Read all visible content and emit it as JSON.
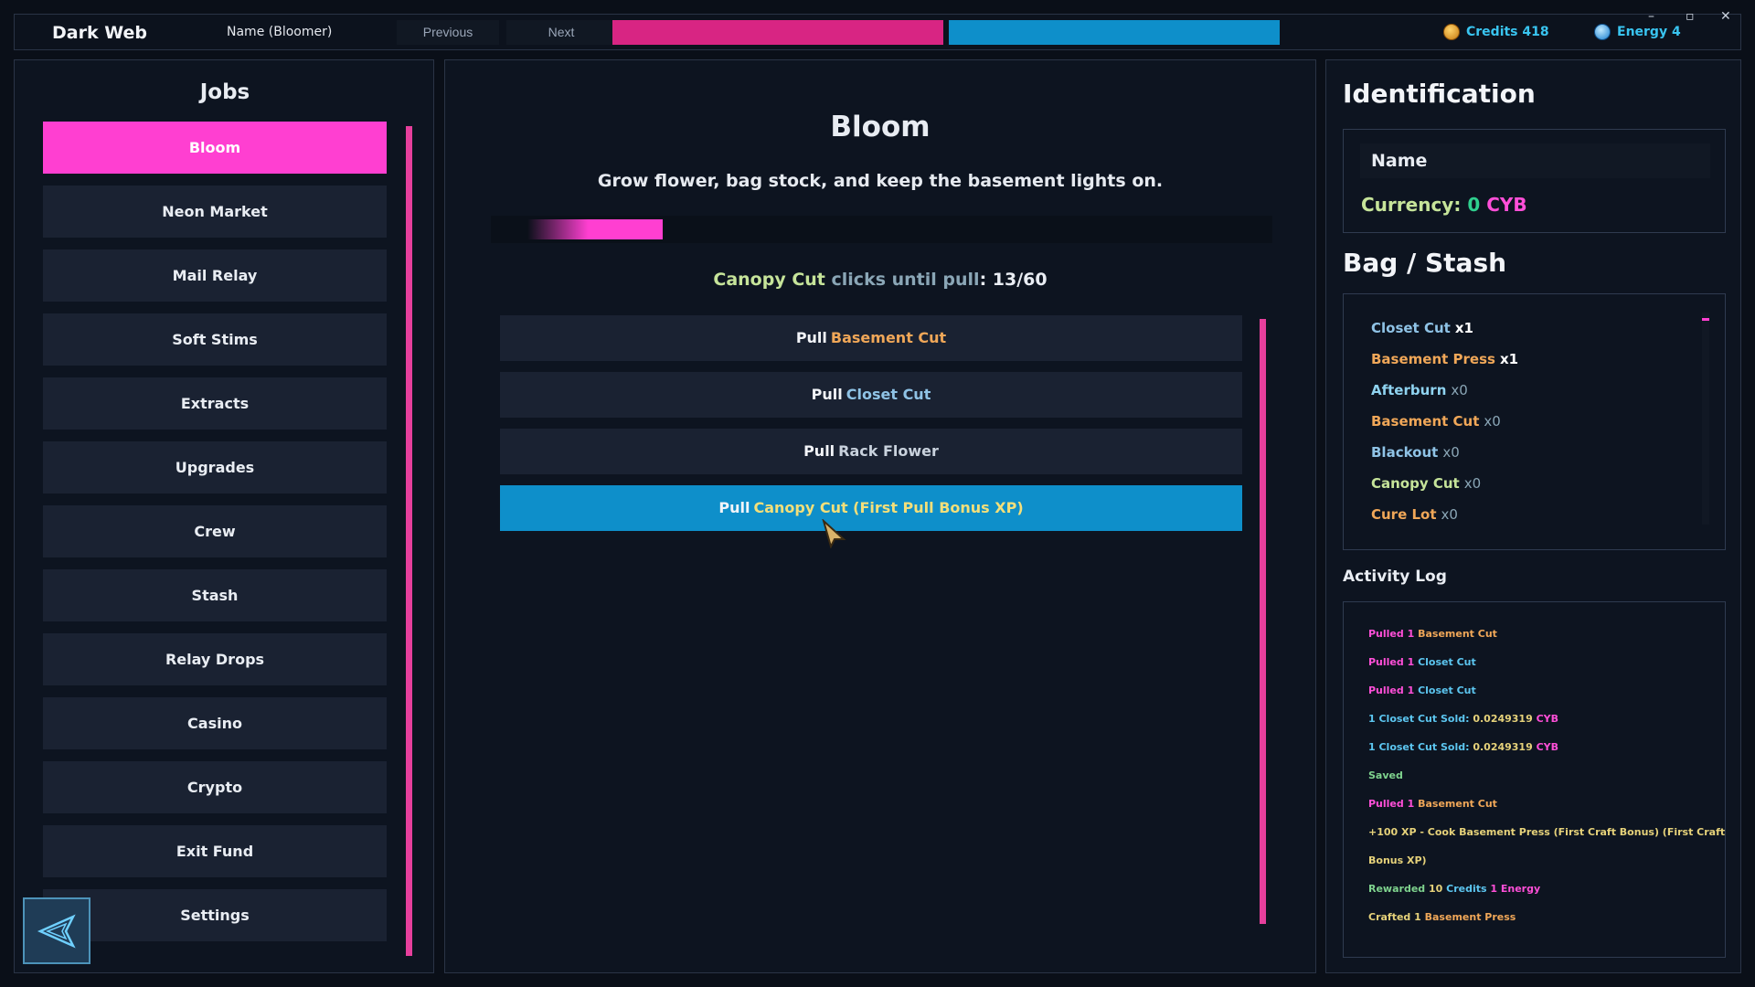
{
  "topbar": {
    "brand": "Dark Web",
    "user": "Name (Bloomer)",
    "previous_label": "Previous",
    "next_label": "Next",
    "credits_label": "Credits 418",
    "energy_label": "Energy 4",
    "pink_bar_fill": 1.0,
    "blue_bar_fill": 1.0
  },
  "jobs": {
    "title": "Jobs",
    "items": [
      {
        "label": "Bloom",
        "active": true
      },
      {
        "label": "Neon Market"
      },
      {
        "label": "Mail Relay"
      },
      {
        "label": "Soft Stims"
      },
      {
        "label": "Extracts"
      },
      {
        "label": "Upgrades"
      },
      {
        "label": "Crew"
      },
      {
        "label": "Stash"
      },
      {
        "label": "Relay Drops"
      },
      {
        "label": "Casino"
      },
      {
        "label": "Crypto"
      },
      {
        "label": "Exit Fund"
      },
      {
        "label": "Settings"
      }
    ]
  },
  "main": {
    "title": "Bloom",
    "description": "Grow flower, bag stock, and keep the basement lights on.",
    "progress_fraction": 0.22,
    "clicks_item": "Canopy Cut",
    "clicks_mid": "clicks until pull",
    "clicks_count": ": 13/60",
    "pull_prefix": "Pull",
    "pulls": [
      {
        "name": "Basement Cut",
        "color": "#f0a758"
      },
      {
        "name": "Closet Cut",
        "color": "#8fc3e6"
      },
      {
        "name": "Rack Flower",
        "color": "#c9d2dd"
      },
      {
        "name": "Canopy Cut (First Pull Bonus XP)",
        "color": "#f3df7a",
        "active": true
      }
    ]
  },
  "identification": {
    "title": "Identification",
    "name": "Name",
    "currency_label": "Currency:",
    "currency_value": "0",
    "currency_unit": "CYB"
  },
  "bag": {
    "title": "Bag / Stash",
    "items": [
      {
        "name": "Closet Cut",
        "qty": "x1",
        "color": "#8fc3e6",
        "bright": true
      },
      {
        "name": "Basement Press",
        "qty": "x1",
        "color": "#f0a758",
        "bright": true
      },
      {
        "name": "Afterburn",
        "qty": "x0",
        "color": "#8fd3f0"
      },
      {
        "name": "Basement Cut",
        "qty": "x0",
        "color": "#f0a758"
      },
      {
        "name": "Blackout",
        "qty": "x0",
        "color": "#8fc3e6"
      },
      {
        "name": "Canopy Cut",
        "qty": "x0",
        "color": "#c6e49a"
      },
      {
        "name": "Cure Lot",
        "qty": "x0",
        "color": "#f0a758"
      }
    ]
  },
  "activity": {
    "title": "Activity Log",
    "lines": [
      [
        {
          "t": "Pulled 1 ",
          "c": "pk"
        },
        {
          "t": "Basement Cut",
          "c": "or"
        }
      ],
      [
        {
          "t": "Pulled 1 ",
          "c": "pk"
        },
        {
          "t": "Closet Cut",
          "c": "bl"
        }
      ],
      [
        {
          "t": "Pulled 1 ",
          "c": "pk"
        },
        {
          "t": "Closet Cut",
          "c": "bl"
        }
      ],
      [
        {
          "t": "1 Closet Cut Sold: ",
          "c": "bl"
        },
        {
          "t": "0.0249319",
          "c": "yl"
        },
        {
          "t": " CYB",
          "c": "pk"
        }
      ],
      [
        {
          "t": "1 Closet Cut Sold: ",
          "c": "bl"
        },
        {
          "t": "0.0249319",
          "c": "yl"
        },
        {
          "t": " CYB",
          "c": "pk"
        }
      ],
      [
        {
          "t": "Saved",
          "c": "gr"
        }
      ],
      [
        {
          "t": "Pulled 1 ",
          "c": "pk"
        },
        {
          "t": "Basement Cut",
          "c": "or"
        }
      ],
      [
        {
          "t": "+100 XP - Cook Basement Press (First Craft Bonus) (First Craft",
          "c": "yl"
        }
      ],
      [
        {
          "t": "Bonus XP)",
          "c": "yl"
        }
      ],
      [
        {
          "t": "Rewarded ",
          "c": "gr"
        },
        {
          "t": "10",
          "c": "yl"
        },
        {
          "t": " Credits",
          "c": "bl"
        },
        {
          "t": " 1 Energy",
          "c": "pk"
        }
      ],
      [
        {
          "t": "Crafted 1 ",
          "c": "yl"
        },
        {
          "t": "Basement Press",
          "c": "or"
        }
      ]
    ]
  },
  "colors": {
    "accent_pink": "#ff3fd1",
    "accent_blue": "#0e8fca"
  }
}
